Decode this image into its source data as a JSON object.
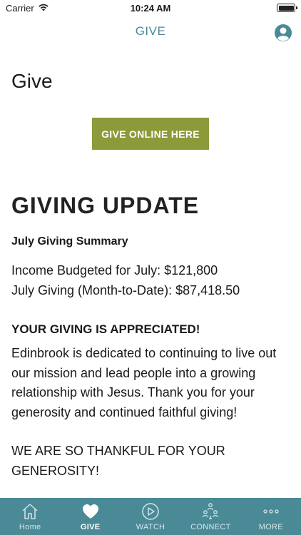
{
  "status_bar": {
    "carrier": "Carrier",
    "time": "10:24 AM"
  },
  "nav": {
    "title": "GIVE",
    "profile_icon": "person-circle-icon"
  },
  "page": {
    "title": "Give",
    "give_button_label": "GIVE ONLINE HERE",
    "update_heading": "GIVING UPDATE",
    "summary_heading": "July Giving Summary",
    "income_line": "Income Budgeted for July: $121,800",
    "giving_line": "July Giving (Month-to-Date): $87,418.50",
    "appreciated_heading": "YOUR GIVING IS APPRECIATED!",
    "paragraph_1": "Edinbrook is dedicated to continuing to live out our mission and lead people into a growing relationship with Jesus. Thank you for your generosity and continued faithful giving!",
    "paragraph_2": "WE ARE SO THANKFUL FOR YOUR GENEROSITY!"
  },
  "tabs": [
    {
      "label": "Home",
      "icon": "home-icon",
      "active": false
    },
    {
      "label": "GIVE",
      "icon": "heart-icon",
      "active": true
    },
    {
      "label": "WATCH",
      "icon": "play-icon",
      "active": false
    },
    {
      "label": "CONNECT",
      "icon": "people-icon",
      "active": false
    },
    {
      "label": "MORE",
      "icon": "more-dots-icon",
      "active": false
    }
  ],
  "colors": {
    "accent": "#4a8a96",
    "button": "#8c9a3a",
    "text": "#1a1a1a"
  }
}
